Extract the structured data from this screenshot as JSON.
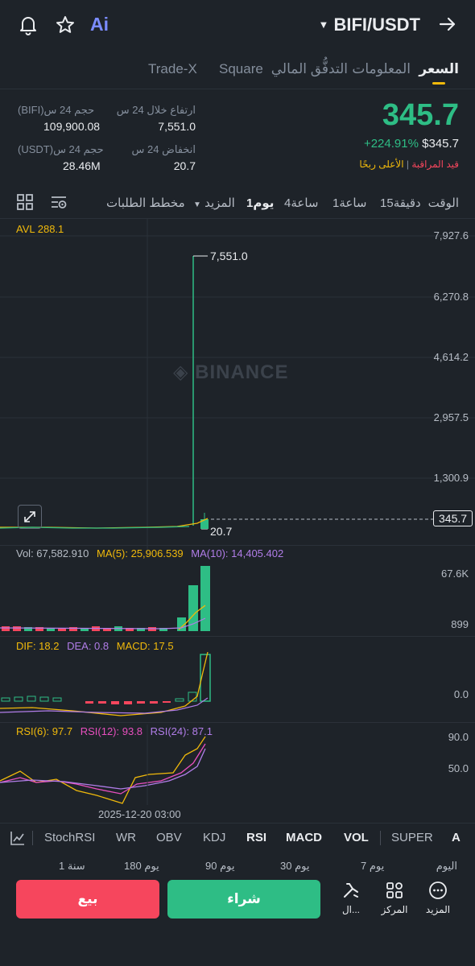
{
  "header": {
    "pair": "BIFI/USDT",
    "icons": [
      "bell-icon",
      "star-icon",
      "ai-icon",
      "caret-down-icon",
      "share-arrow-icon"
    ],
    "ai_label": "Ai"
  },
  "tabs": [
    "السعر",
    "المعلومات",
    "التدفُّق المالي",
    "Square",
    "Trade-X"
  ],
  "price": {
    "last": "345.7",
    "change": "+224.91%",
    "usd": "$345.7",
    "tag_watch": "قيد المراقبة",
    "tag_gainer": "الأعلى ربحًا",
    "high_label": "ارتفاع خلال 24 س",
    "high_value": "7,551.0",
    "low_label": "انخفاض 24 س",
    "low_value": "20.7",
    "vol_base_label": "حجم 24 س(BIFI)",
    "vol_base_value": "109,900.08",
    "vol_quote_label": "حجم 24 س(USDT)",
    "vol_quote_value": "28.46M"
  },
  "timeframes": {
    "time_label": "الوقت",
    "items": [
      "15دقيقة",
      "1ساعة",
      "4ساعة",
      "1يوم"
    ],
    "more": "المزيد",
    "orderbook": "مخطط الطلبات"
  },
  "chart": {
    "avl": "AVL 288.1",
    "watermark": "BINANCE",
    "y_ticks": [
      "7,927.6",
      "6,270.8",
      "4,614.2",
      "2,957.5",
      "1,300.9"
    ],
    "high_marker": "7,551.0",
    "low_marker": "20.7",
    "current_price": "345.7"
  },
  "volume": {
    "vol": "Vol: 67,582.910",
    "ma5": "MA(5): 25,906.539",
    "ma10": "MA(10): 14,405.402",
    "y_top": "67.6K",
    "y_bottom": "899"
  },
  "macd": {
    "dif": "DIF: 18.2",
    "dea": "DEA: 0.8",
    "macd": "MACD: 17.5",
    "y_zero": "0.0"
  },
  "rsi": {
    "rsi6": "RSI(6): 97.7",
    "rsi12": "RSI(12): 93.8",
    "rsi24": "RSI(24): 87.1",
    "y_top": "90.0",
    "y_mid": "50.0",
    "date": "2025-12-20 03:00"
  },
  "indicators": [
    "StochRSI",
    "WR",
    "OBV",
    "KDJ",
    "RSI",
    "MACD",
    "VOL",
    "SUPER",
    "A"
  ],
  "ranges": [
    "اليوم",
    "7 يوم",
    "30 يوم",
    "90 يوم",
    "180 يوم",
    "1 سنة"
  ],
  "actions": {
    "sell": "بيع",
    "buy": "شراء",
    "tools": "ال...",
    "position": "المركز",
    "more": "المزيد"
  }
}
